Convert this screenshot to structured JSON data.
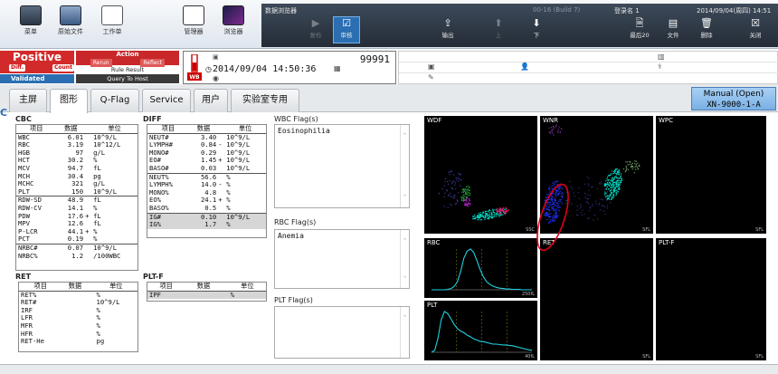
{
  "toolbar": {
    "buttons": [
      {
        "label": "菜单",
        "icon": "menu-icon"
      },
      {
        "label": "原始文件",
        "icon": "file-icon"
      },
      {
        "label": "工作单",
        "icon": "worksheet-icon"
      },
      {
        "label": "管理器",
        "icon": "manager-icon"
      },
      {
        "label": "浏览器",
        "icon": "browser-icon"
      }
    ]
  },
  "browser": {
    "title": "数据浏览器",
    "build": "00-16 (Build 7)",
    "user": "登录名 1",
    "datetime": "2014/09/04(周四) 14:51",
    "buttons": [
      "复检",
      "审核",
      "输出",
      "上",
      "下",
      "最后20",
      "文件",
      "删除",
      "关闭"
    ]
  },
  "status": {
    "result": "Positive",
    "diff": "Diff.",
    "count": "Count",
    "validated": "Validated",
    "action": "Action",
    "rerun": "Rerun",
    "reflect": "Reflect",
    "rule_result": "Rule Result",
    "query_host": "Query To Host"
  },
  "sample": {
    "mode_code": "WB",
    "sample_no": "99991",
    "datetime": "2014/09/04 14:50:36"
  },
  "tabs": [
    "主屏",
    "图形",
    "Q-Flag",
    "Service",
    "用户",
    "实验室专用"
  ],
  "analyzer": {
    "mode": "Manual (Open)",
    "model": "XN-9000-1-A"
  },
  "cbc": {
    "title": "CBC",
    "headers": [
      "项目",
      "数据",
      "单位"
    ],
    "rows": [
      [
        "WBC",
        "6.01",
        "",
        "10^9/L"
      ],
      [
        "RBC",
        "3.19",
        "",
        "10^12/L"
      ],
      [
        "HGB",
        "97",
        "",
        "g/L"
      ],
      [
        "HCT",
        "30.2",
        "",
        "%"
      ],
      [
        "MCV",
        "94.7",
        "",
        "fL"
      ],
      [
        "MCH",
        "30.4",
        "",
        "pg"
      ],
      [
        "MCHC",
        "321",
        "",
        "g/L"
      ],
      [
        "PLT",
        "150",
        "",
        "10^9/L"
      ]
    ],
    "rows2": [
      [
        "RDW-SD",
        "48.9",
        "",
        "fL"
      ],
      [
        "RDW-CV",
        "14.1",
        "",
        "%"
      ],
      [
        "PDW",
        "17.6",
        "+",
        "fL"
      ],
      [
        "MPV",
        "12.6",
        "",
        "fL"
      ],
      [
        "P-LCR",
        "44.1",
        "+",
        "%"
      ],
      [
        "PCT",
        "0.19",
        "",
        "%"
      ]
    ],
    "rows3": [
      [
        "NRBC#",
        "0.07",
        "",
        "10^9/L"
      ],
      [
        "NRBC%",
        "1.2",
        "",
        "/100WBC"
      ]
    ]
  },
  "diff": {
    "title": "DIFF",
    "headers": [
      "项目",
      "数据",
      "单位"
    ],
    "rows": [
      [
        "NEUT#",
        "3.40",
        "",
        "10^9/L"
      ],
      [
        "LYMPH#",
        "0.84",
        "-",
        "10^9/L"
      ],
      [
        "MONO#",
        "0.29",
        "",
        "10^9/L"
      ],
      [
        "EO#",
        "1.45",
        "+",
        "10^9/L"
      ],
      [
        "BASO#",
        "0.03",
        "",
        "10^9/L"
      ]
    ],
    "rows2": [
      [
        "NEUT%",
        "56.6",
        "",
        "%"
      ],
      [
        "LYMPH%",
        "14.0",
        "-",
        "%"
      ],
      [
        "MONO%",
        "4.8",
        "",
        "%"
      ],
      [
        "EO%",
        "24.1",
        "+",
        "%"
      ],
      [
        "BASO%",
        "0.5",
        "",
        "%"
      ]
    ],
    "rows3": [
      [
        "IG#",
        "0.10",
        "",
        "10^9/L"
      ],
      [
        "IG%",
        "1.7",
        "",
        "%"
      ]
    ]
  },
  "ret": {
    "title": "RET",
    "headers": [
      "项目",
      "数据",
      "单位"
    ],
    "rows": [
      [
        "RET%",
        "",
        "",
        "%"
      ],
      [
        "RET#",
        "",
        "",
        "10^9/L"
      ],
      [
        "IRF",
        "",
        "",
        "%"
      ],
      [
        "LFR",
        "",
        "",
        "%"
      ],
      [
        "MFR",
        "",
        "",
        "%"
      ],
      [
        "HFR",
        "",
        "",
        "%"
      ],
      [
        "RET-He",
        "",
        "",
        "pg"
      ]
    ]
  },
  "pltf": {
    "title": "PLT-F",
    "headers": [
      "项目",
      "数据",
      "单位"
    ],
    "rows": [
      [
        "IPF",
        "",
        "",
        "%"
      ]
    ]
  },
  "flags": {
    "wbc_title": "WBC Flag(s)",
    "wbc": "Eosinophilia",
    "rbc_title": "RBC Flag(s)",
    "rbc": "Anemia",
    "plt_title": "PLT Flag(s)",
    "plt": ""
  },
  "graphs": {
    "wdf": "WDF",
    "wnr": "WNR",
    "wpc": "WPC",
    "rbc": "RBC",
    "plt": "PLT",
    "ret": "RET",
    "pltf": "PLT-F",
    "ssc": "SSC",
    "sfl": "SFL",
    "fsc_rbc": "250fL",
    "fsc_plt": "40fL",
    "rbc_curve": [
      0,
      0,
      0,
      0,
      0,
      0.01,
      0.03,
      0.08,
      0.2,
      0.45,
      0.78,
      0.95,
      1.0,
      0.92,
      0.72,
      0.5,
      0.32,
      0.2,
      0.13,
      0.09,
      0.06,
      0.04,
      0.03,
      0.02,
      0.02,
      0.01,
      0.01,
      0.01,
      0,
      0,
      0,
      0
    ],
    "plt_curve": [
      0,
      0.05,
      0.35,
      0.8,
      1.0,
      0.95,
      0.82,
      0.68,
      0.58,
      0.52,
      0.48,
      0.42,
      0.38,
      0.33,
      0.3,
      0.27,
      0.26,
      0.24,
      0.22,
      0.2,
      0.2,
      0.19,
      0.18,
      0.18,
      0.17,
      0.16,
      0.14,
      0.12,
      0.1,
      0.08,
      0.06,
      0.05
    ]
  },
  "colors": {
    "positive": "#d22a2a",
    "validated": "#2b6fb2",
    "neut": "#00d8c4",
    "eo": "#e01060",
    "mono": "#22a83a",
    "lymph": "#2030f0",
    "baso": "#b020c0",
    "annotation": "#e0001a"
  }
}
